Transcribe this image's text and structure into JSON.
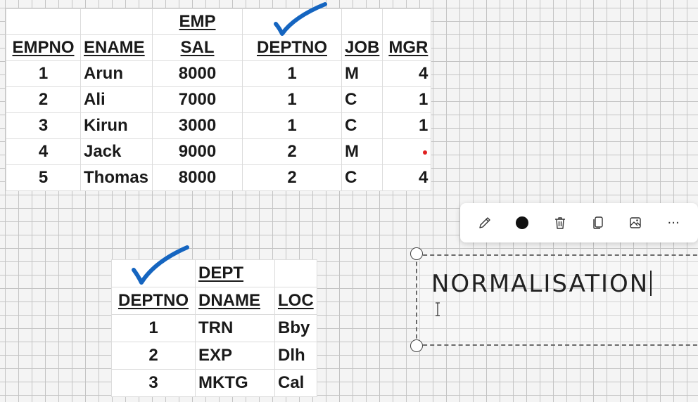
{
  "emp_table": {
    "title": "EMP",
    "headers": [
      "EMPNO",
      "ENAME",
      "SAL",
      "DEPTNO",
      "JOB",
      "MGR"
    ],
    "rows": [
      [
        "1",
        "Arun",
        "8000",
        "1",
        "M",
        "4"
      ],
      [
        "2",
        "Ali",
        "7000",
        "1",
        "C",
        "1"
      ],
      [
        "3",
        "Kirun",
        "3000",
        "1",
        "C",
        "1"
      ],
      [
        "4",
        "Jack",
        "9000",
        "2",
        "M",
        ""
      ],
      [
        "5",
        "Thomas",
        "8000",
        "2",
        "C",
        "4"
      ]
    ]
  },
  "dept_table": {
    "title": "DEPT",
    "headers": [
      "DEPTNO",
      "DNAME",
      "LOC"
    ],
    "rows": [
      [
        "1",
        "TRN",
        "Bby"
      ],
      [
        "2",
        "EXP",
        "Dlh"
      ],
      [
        "3",
        "MKTG",
        "Cal"
      ]
    ]
  },
  "annotation_colors": {
    "check": "#1565c0",
    "dot": "#e02020"
  },
  "toolbar": {
    "icons": [
      "pencil-icon",
      "color-dot-icon",
      "trash-icon",
      "copy-icon",
      "image-icon",
      "more-icon"
    ],
    "more_label": "···"
  },
  "textbox": {
    "text": "NORMALISATION"
  }
}
